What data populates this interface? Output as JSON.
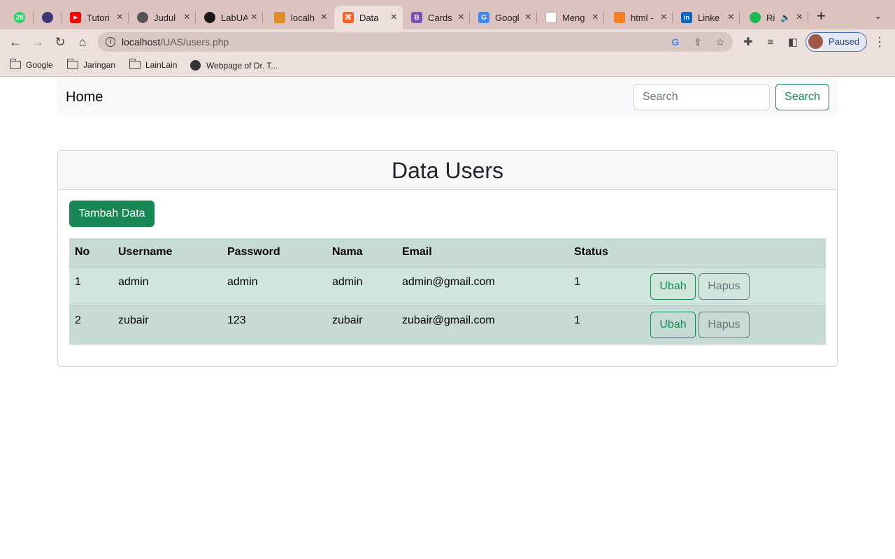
{
  "browser": {
    "tabs": [
      {
        "title": "",
        "favicon": "whatsapp-icon",
        "color": "#25d366",
        "glyph": "28"
      },
      {
        "title": "",
        "favicon": "hacker-icon",
        "color": "#3b3575",
        "glyph": ""
      },
      {
        "title": "Tutori",
        "favicon": "youtube-icon",
        "color": "#ff0000",
        "glyph": "▶"
      },
      {
        "title": "Judul",
        "favicon": "globe-icon",
        "color": "#555555",
        "glyph": ""
      },
      {
        "title": "LabUA",
        "favicon": "github-icon",
        "color": "#1a1a1a",
        "glyph": ""
      },
      {
        "title": "localh",
        "favicon": "phpmyadmin-icon",
        "color": "#e08a2a",
        "glyph": ""
      },
      {
        "title": "Data",
        "favicon": "xampp-icon",
        "color": "#f26522",
        "glyph": "⌘",
        "active": true
      },
      {
        "title": "Cards",
        "favicon": "bootstrap-icon",
        "color": "#7952b3",
        "glyph": "B"
      },
      {
        "title": "Googl",
        "favicon": "google-translate-icon",
        "color": "#4285f4",
        "glyph": "G"
      },
      {
        "title": "Meng",
        "favicon": "doc-icon",
        "color": "#c9a9a4",
        "glyph": ""
      },
      {
        "title": "html -",
        "favicon": "stackoverflow-icon",
        "color": "#f48024",
        "glyph": ""
      },
      {
        "title": "Linke",
        "favicon": "linkedin-icon",
        "color": "#0a66c2",
        "glyph": "in"
      },
      {
        "title": "Ri",
        "favicon": "spotify-icon",
        "color": "#1db954",
        "glyph": "≋"
      }
    ],
    "url_host": "localhost",
    "url_path": "/UAS/users.php",
    "profile_status": "Paused",
    "bookmarks": [
      {
        "label": "Google",
        "icon": "folder-icon"
      },
      {
        "label": "Jaringan",
        "icon": "folder-icon"
      },
      {
        "label": "LainLain",
        "icon": "folder-icon"
      },
      {
        "label": "Webpage of Dr. T...",
        "icon": "globe-icon"
      }
    ]
  },
  "navbar": {
    "brand": "Home",
    "search_placeholder": "Search",
    "search_button": "Search"
  },
  "card": {
    "title": "Data Users",
    "add_button": "Tambah Data"
  },
  "table": {
    "headers": [
      "No",
      "Username",
      "Password",
      "Nama",
      "Email",
      "Status",
      ""
    ],
    "rows": [
      {
        "no": "1",
        "username": "admin",
        "password": "admin",
        "nama": "admin",
        "email": "admin@gmail.com",
        "status": "1",
        "edit": "Ubah",
        "delete": "Hapus"
      },
      {
        "no": "2",
        "username": "zubair",
        "password": "123",
        "nama": "zubair",
        "email": "zubair@gmail.com",
        "status": "1",
        "edit": "Ubah",
        "delete": "Hapus"
      }
    ]
  },
  "colors": {
    "primary_success": "#198754",
    "table_row_odd": "#d0e6dd",
    "table_row_even": "#c7dbd4",
    "tabstrip": "#dcc3bf"
  }
}
